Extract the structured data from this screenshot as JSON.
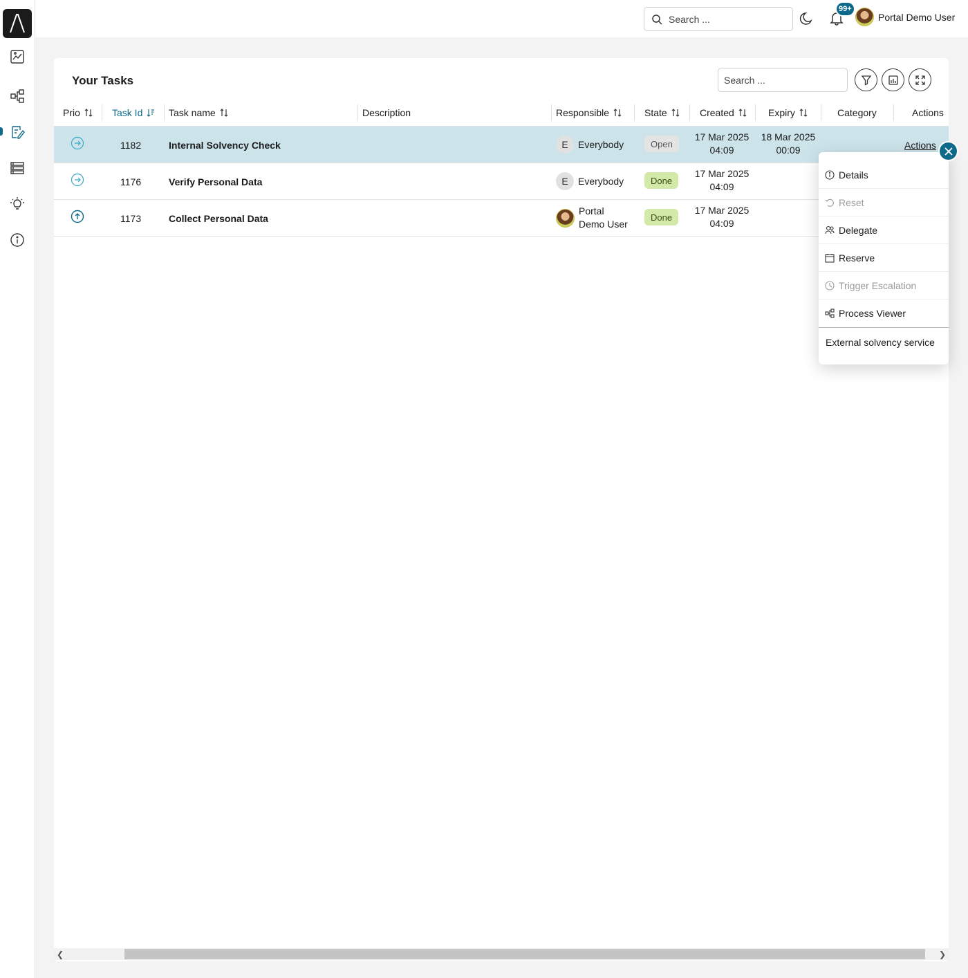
{
  "app": {
    "logo": "axon-logo"
  },
  "sidebar": {
    "items": [
      {
        "icon": "dashboard-icon"
      },
      {
        "icon": "process-icon"
      },
      {
        "icon": "tasks-icon",
        "active": true
      },
      {
        "icon": "list-icon"
      },
      {
        "icon": "lightbulb-icon"
      },
      {
        "icon": "info-icon"
      }
    ]
  },
  "topbar": {
    "search_placeholder": "Search ...",
    "notifications_badge": "99+",
    "user_name": "Portal Demo User"
  },
  "tasks": {
    "title": "Your Tasks",
    "search_placeholder": "Search ...",
    "columns": {
      "prio": "Prio",
      "task_id": "Task Id",
      "task_name": "Task name",
      "description": "Description",
      "responsible": "Responsible",
      "state": "State",
      "created": "Created",
      "expiry": "Expiry",
      "category": "Category",
      "actions": "Actions"
    },
    "rows": [
      {
        "prio": "normal",
        "id": "1182",
        "name": "Internal Solvency Check",
        "description": "",
        "responsible_initial": "E",
        "responsible": "Everybody",
        "state": "Open",
        "created_date": "17 Mar 2025",
        "created_time": "04:09",
        "expiry_date": "18 Mar 2025",
        "expiry_time": "00:09",
        "category": "",
        "actions": "Actions"
      },
      {
        "prio": "normal",
        "id": "1176",
        "name": "Verify Personal Data",
        "description": "",
        "responsible_initial": "E",
        "responsible": "Everybody",
        "state": "Done",
        "created_date": "17 Mar 2025",
        "created_time": "04:09",
        "expiry_date": "",
        "expiry_time": "",
        "category": ""
      },
      {
        "prio": "high",
        "id": "1173",
        "name": "Collect Personal Data",
        "description": "",
        "responsible_line1": "Portal",
        "responsible_line2": "Demo User",
        "state": "Done",
        "created_date": "17 Mar 2025",
        "created_time": "04:09",
        "expiry_date": "",
        "expiry_time": "",
        "category": ""
      }
    ]
  },
  "actions_menu": {
    "items": [
      {
        "label": "Details",
        "icon": "info-circle-icon",
        "enabled": true
      },
      {
        "label": "Reset",
        "icon": "undo-icon",
        "enabled": false
      },
      {
        "label": "Delegate",
        "icon": "users-icon",
        "enabled": true
      },
      {
        "label": "Reserve",
        "icon": "calendar-icon",
        "enabled": true
      },
      {
        "label": "Trigger Escalation",
        "icon": "clock-icon",
        "enabled": false
      },
      {
        "label": "Process Viewer",
        "icon": "process-icon",
        "enabled": true
      }
    ],
    "footer": "External solvency service"
  },
  "colors": {
    "accent": "#0f6a8a",
    "selected_row": "#cde3ea",
    "done_badge": "#d2e9a8",
    "open_badge": "#e4e4e4"
  }
}
